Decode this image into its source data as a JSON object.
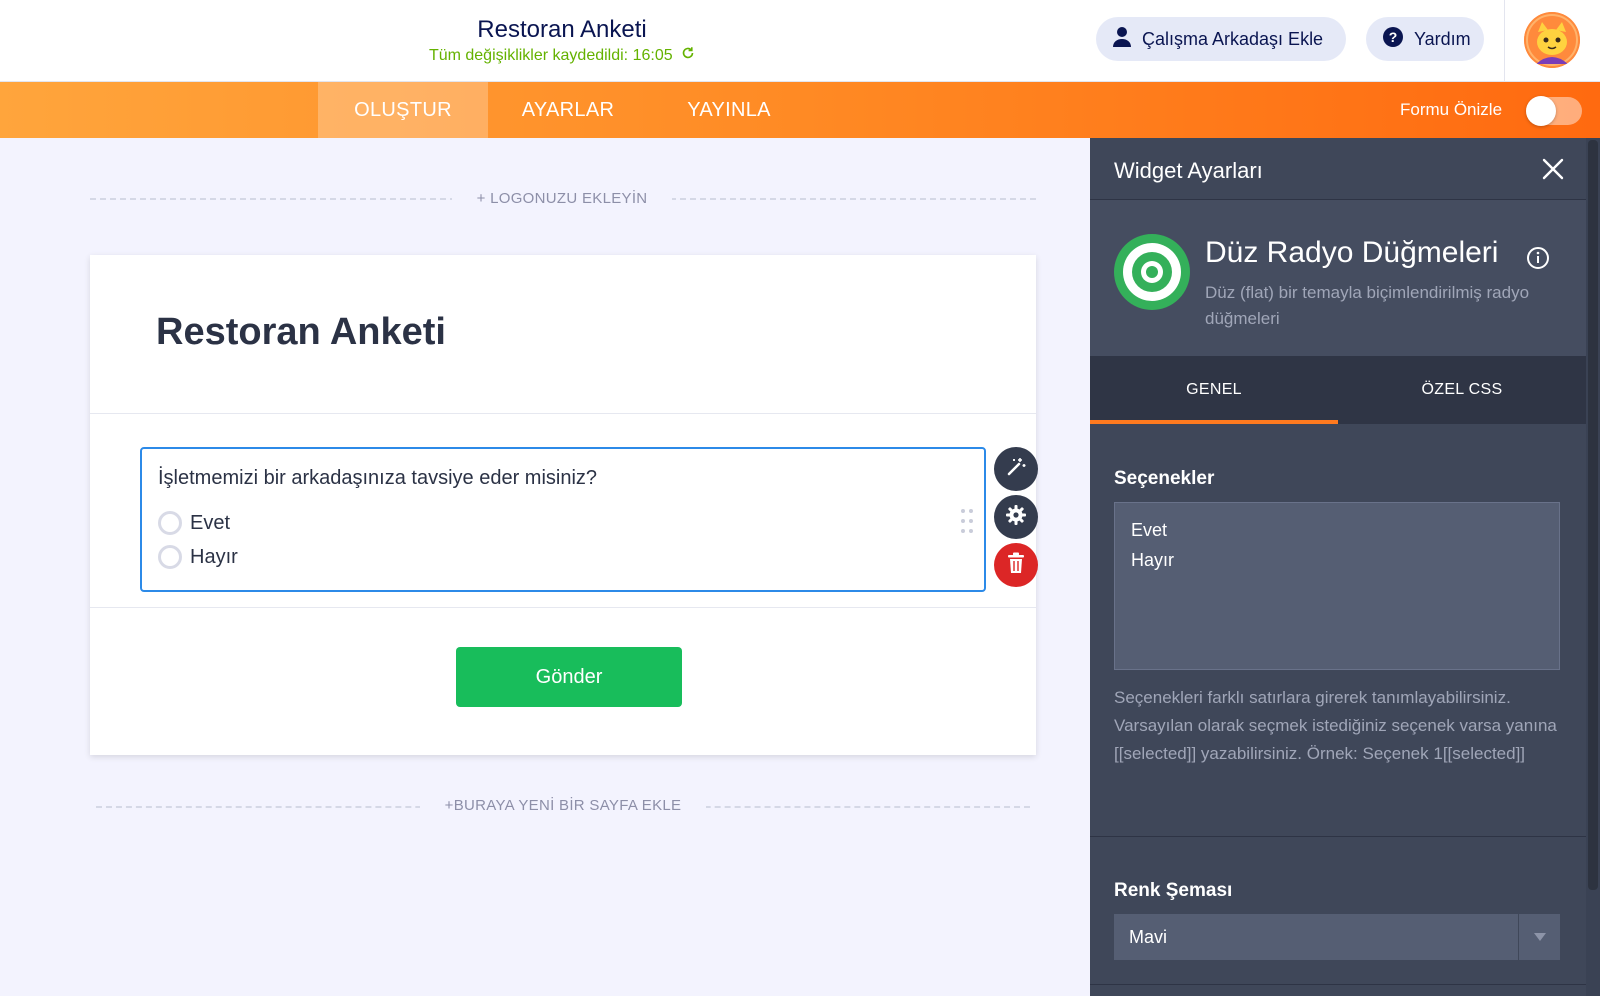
{
  "header": {
    "title": "Restoran Anketi",
    "saved_status": "Tüm değişiklikler kaydedildi: 16:05",
    "collaborator_button": "Çalışma Arkadaşı Ekle",
    "help_button": "Yardım"
  },
  "nav": {
    "tabs": [
      {
        "label": "OLUŞTUR",
        "active": true
      },
      {
        "label": "AYARLAR",
        "active": false
      },
      {
        "label": "YAYINLA",
        "active": false
      }
    ],
    "preview_label": "Formu Önizle",
    "preview_enabled": false
  },
  "canvas": {
    "add_logo": "+ LOGONUZU EKLEYİN",
    "form_title": "Restoran Anketi",
    "question": {
      "label": "İşletmemizi bir arkadaşınıza tavsiye eder misiniz?",
      "options": [
        "Evet",
        "Hayır"
      ]
    },
    "submit_label": "Gönder",
    "add_page": "+BURAYA YENİ BİR SAYFA EKLE"
  },
  "panel": {
    "title": "Widget Ayarları",
    "widget": {
      "name": "Düz Radyo Düğmeleri",
      "description": "Düz (flat) bir temayla biçimlendirilmiş radyo düğmeleri"
    },
    "tabs": [
      {
        "label": "GENEL",
        "active": true
      },
      {
        "label": "ÖZEL CSS",
        "active": false
      }
    ],
    "options_label": "Seçenekler",
    "options_values": [
      "Evet",
      "Hayır"
    ],
    "options_help": "Seçenekleri farklı satırlara girerek tanımlayabilirsiniz. Varsayılan olarak seçmek istediğiniz seçenek varsa yanına [[selected]] yazabilirsiniz. Örnek: Seçenek 1[[selected]]",
    "color_scheme_label": "Renk Şeması",
    "color_scheme_value": "Mavi"
  },
  "colors": {
    "accent_orange": "#ff7a1f",
    "focus_blue": "#2c8ae8",
    "submit_green": "#18bd5b",
    "delete_red": "#dc2626",
    "panel_bg": "#3f4759",
    "saved_green": "#64b200"
  },
  "icons": {
    "collaborator": "user-icon",
    "help": "question-circle-icon",
    "saved": "refresh-icon",
    "wand": "magic-wand-icon",
    "gear": "gear-icon",
    "trash": "trash-icon",
    "close": "close-icon",
    "info": "info-icon",
    "widget": "radio-target-icon",
    "select": "chevron-down-icon"
  }
}
